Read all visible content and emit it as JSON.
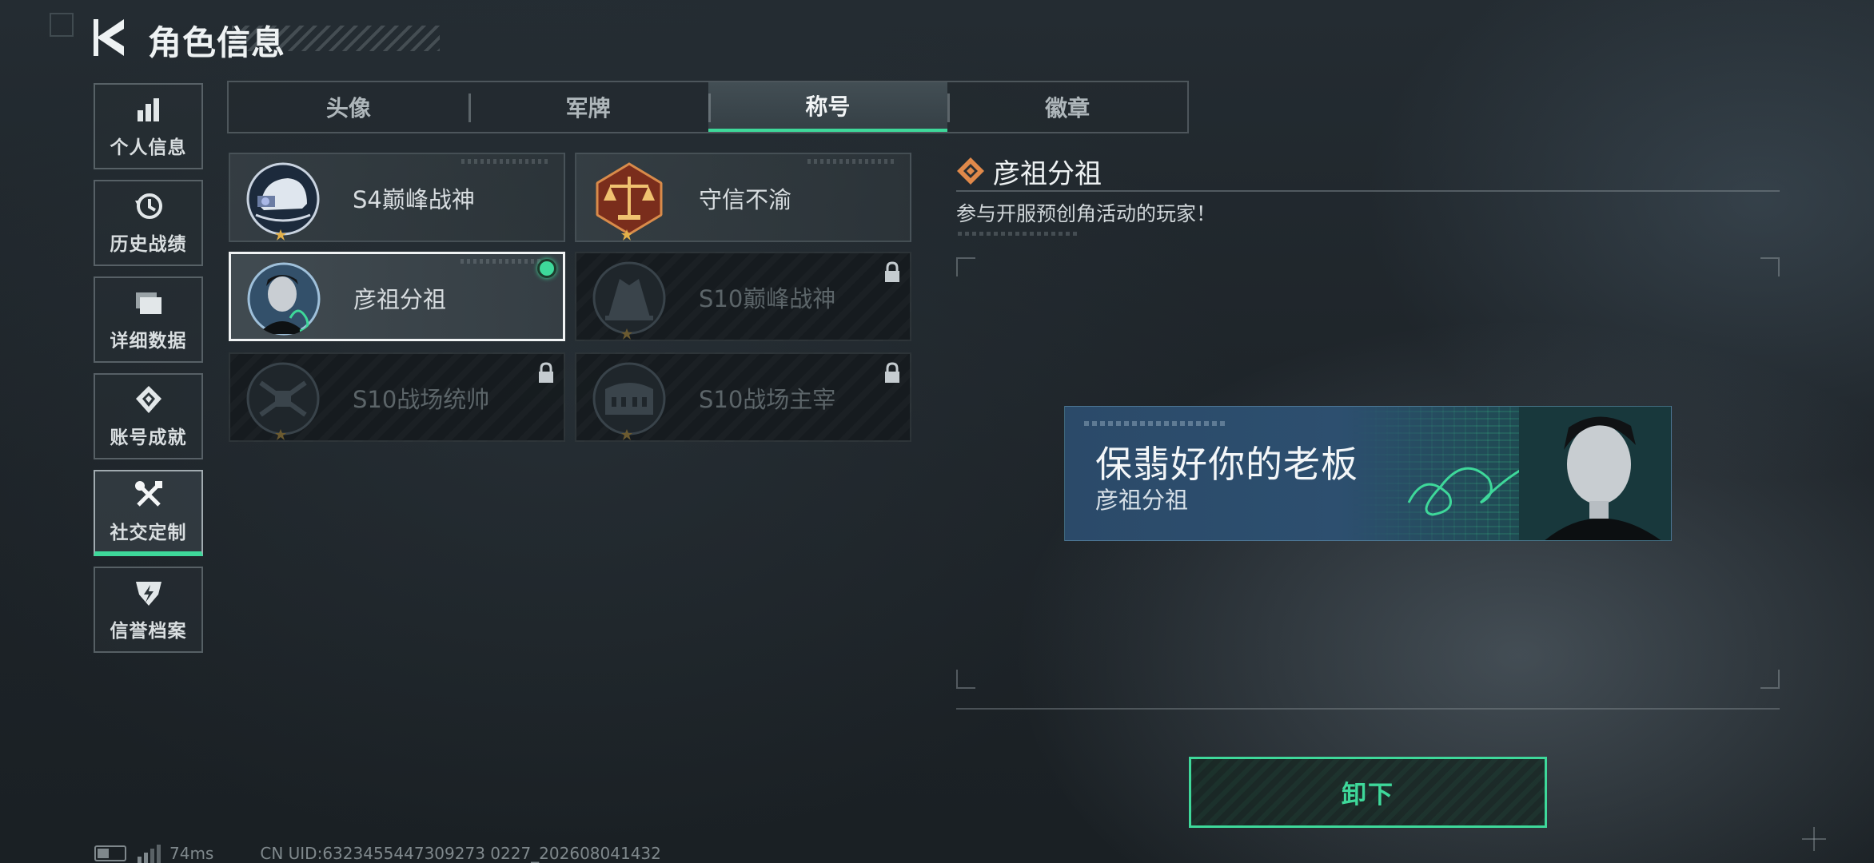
{
  "header": {
    "title": "角色信息"
  },
  "sidebar": {
    "items": [
      {
        "label": "个人信息",
        "icon": "bar-chart-icon",
        "active": false
      },
      {
        "label": "历史战绩",
        "icon": "history-icon",
        "active": false
      },
      {
        "label": "详细数据",
        "icon": "folder-icon",
        "active": false
      },
      {
        "label": "账号成就",
        "icon": "medal-icon",
        "active": false
      },
      {
        "label": "社交定制",
        "icon": "tools-icon",
        "active": true
      },
      {
        "label": "信誉档案",
        "icon": "shield-icon",
        "active": false
      }
    ]
  },
  "tabs": [
    {
      "label": "头像",
      "active": false
    },
    {
      "label": "军牌",
      "active": false
    },
    {
      "label": "称号",
      "active": true
    },
    {
      "label": "徽章",
      "active": false
    }
  ],
  "titles": [
    {
      "label": "S4巅峰战神",
      "state": "unlocked"
    },
    {
      "label": "守信不渝",
      "state": "unlocked"
    },
    {
      "label": "彦祖分祖",
      "state": "equipped"
    },
    {
      "label": "S10巅峰战神",
      "state": "locked"
    },
    {
      "label": "S10战场统帅",
      "state": "locked"
    },
    {
      "label": "S10战场主宰",
      "state": "locked"
    }
  ],
  "detail": {
    "name": "彦祖分祖",
    "description": "参与开服预创角活动的玩家！",
    "banner": {
      "main_text": "保翡好你的老板",
      "sub_text": "彦祖分祖"
    },
    "action_label": "卸下"
  },
  "status": {
    "ping": "74ms",
    "uid": "CN UID:6323455447309273 0227_202608041432"
  },
  "colors": {
    "accent": "#3ed89a",
    "diamond": "#e0894a"
  }
}
